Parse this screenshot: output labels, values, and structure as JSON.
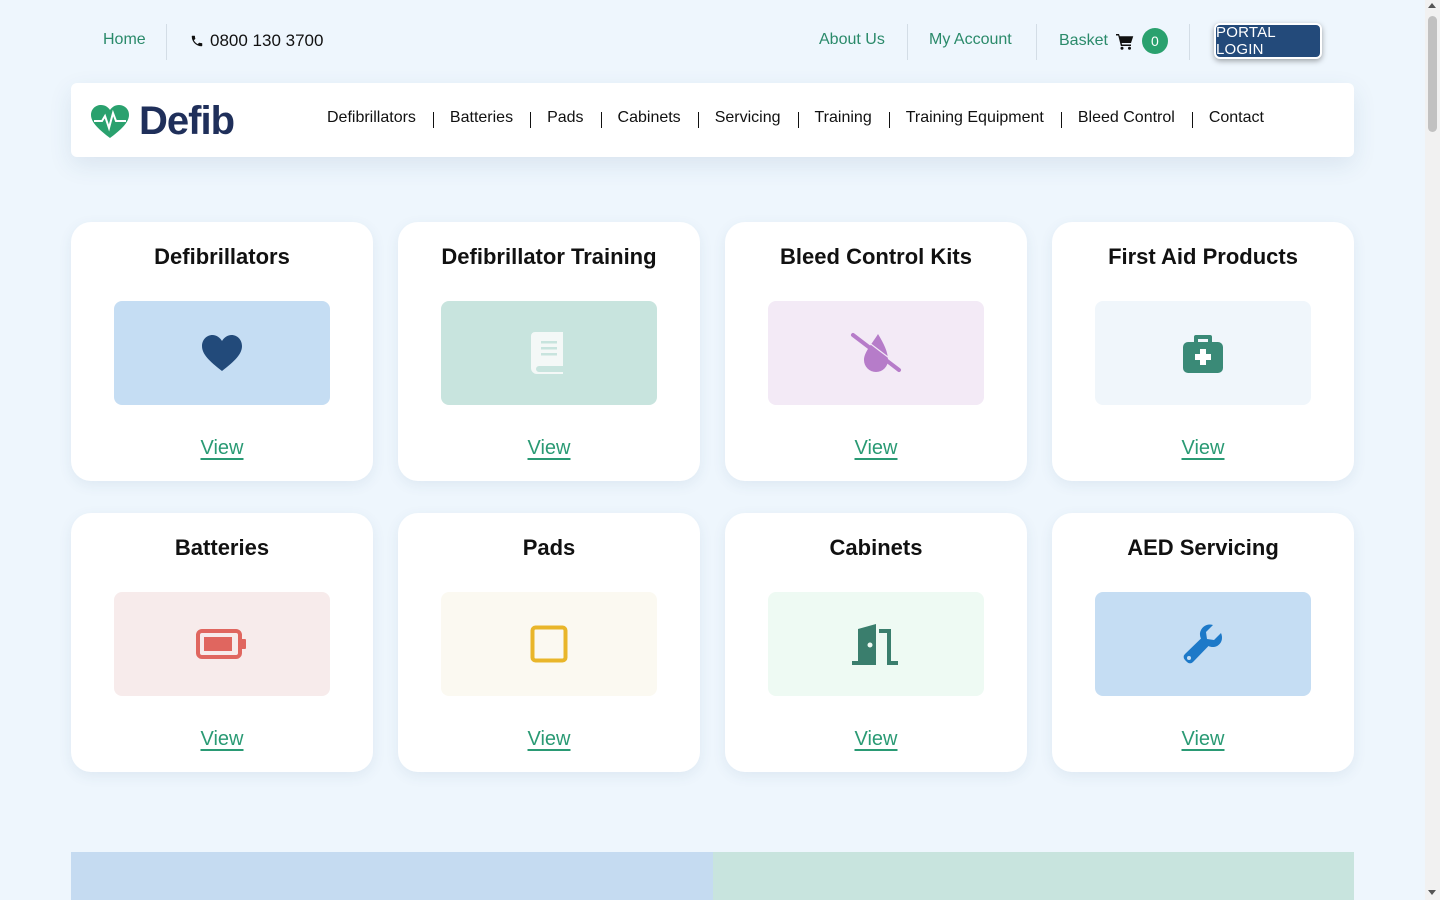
{
  "topbar": {
    "home": "Home",
    "phone": "0800 130 3700",
    "about": "About Us",
    "account": "My Account",
    "basket": "Basket",
    "basket_count": "0",
    "portal": "PORTAL LOGIN"
  },
  "header": {
    "logo_text": "Defib",
    "nav": [
      "Defibrillators",
      "Batteries",
      "Pads",
      "Cabinets",
      "Servicing",
      "Training",
      "Training Equipment",
      "Bleed Control",
      "Contact"
    ]
  },
  "cards": [
    {
      "title": "Defibrillators",
      "link": "View",
      "icon": "heart-icon",
      "bg": "#c5ddf3",
      "color": "#224a7a"
    },
    {
      "title": "Defibrillator Training",
      "link": "View",
      "icon": "book-icon",
      "bg": "#c8e4de",
      "color": "#f4f8f7"
    },
    {
      "title": "Bleed Control Kits",
      "link": "View",
      "icon": "droplet-slash-icon",
      "bg": "#f3eaf6",
      "color": "#b67cc9"
    },
    {
      "title": "First Aid Products",
      "link": "View",
      "icon": "medkit-icon",
      "bg": "#f0f6fb",
      "color": "#3a8a77"
    },
    {
      "title": "Batteries",
      "link": "View",
      "icon": "battery-icon",
      "bg": "#f7ebeb",
      "color": "#e0665f"
    },
    {
      "title": "Pads",
      "link": "View",
      "icon": "square-icon",
      "bg": "#fbf9f1",
      "color": "#e9b62a"
    },
    {
      "title": "Cabinets",
      "link": "View",
      "icon": "door-icon",
      "bg": "#eefaf3",
      "color": "#3a7e6d"
    },
    {
      "title": "AED Servicing",
      "link": "View",
      "icon": "wrench-icon",
      "bg": "#c5ddf3",
      "color": "#1d79c8"
    }
  ],
  "colors": {
    "page_bg": "#eef6fd",
    "accent_green": "#2a9a74",
    "navy": "#1f2f5a",
    "portal_bg": "#234a7a"
  }
}
